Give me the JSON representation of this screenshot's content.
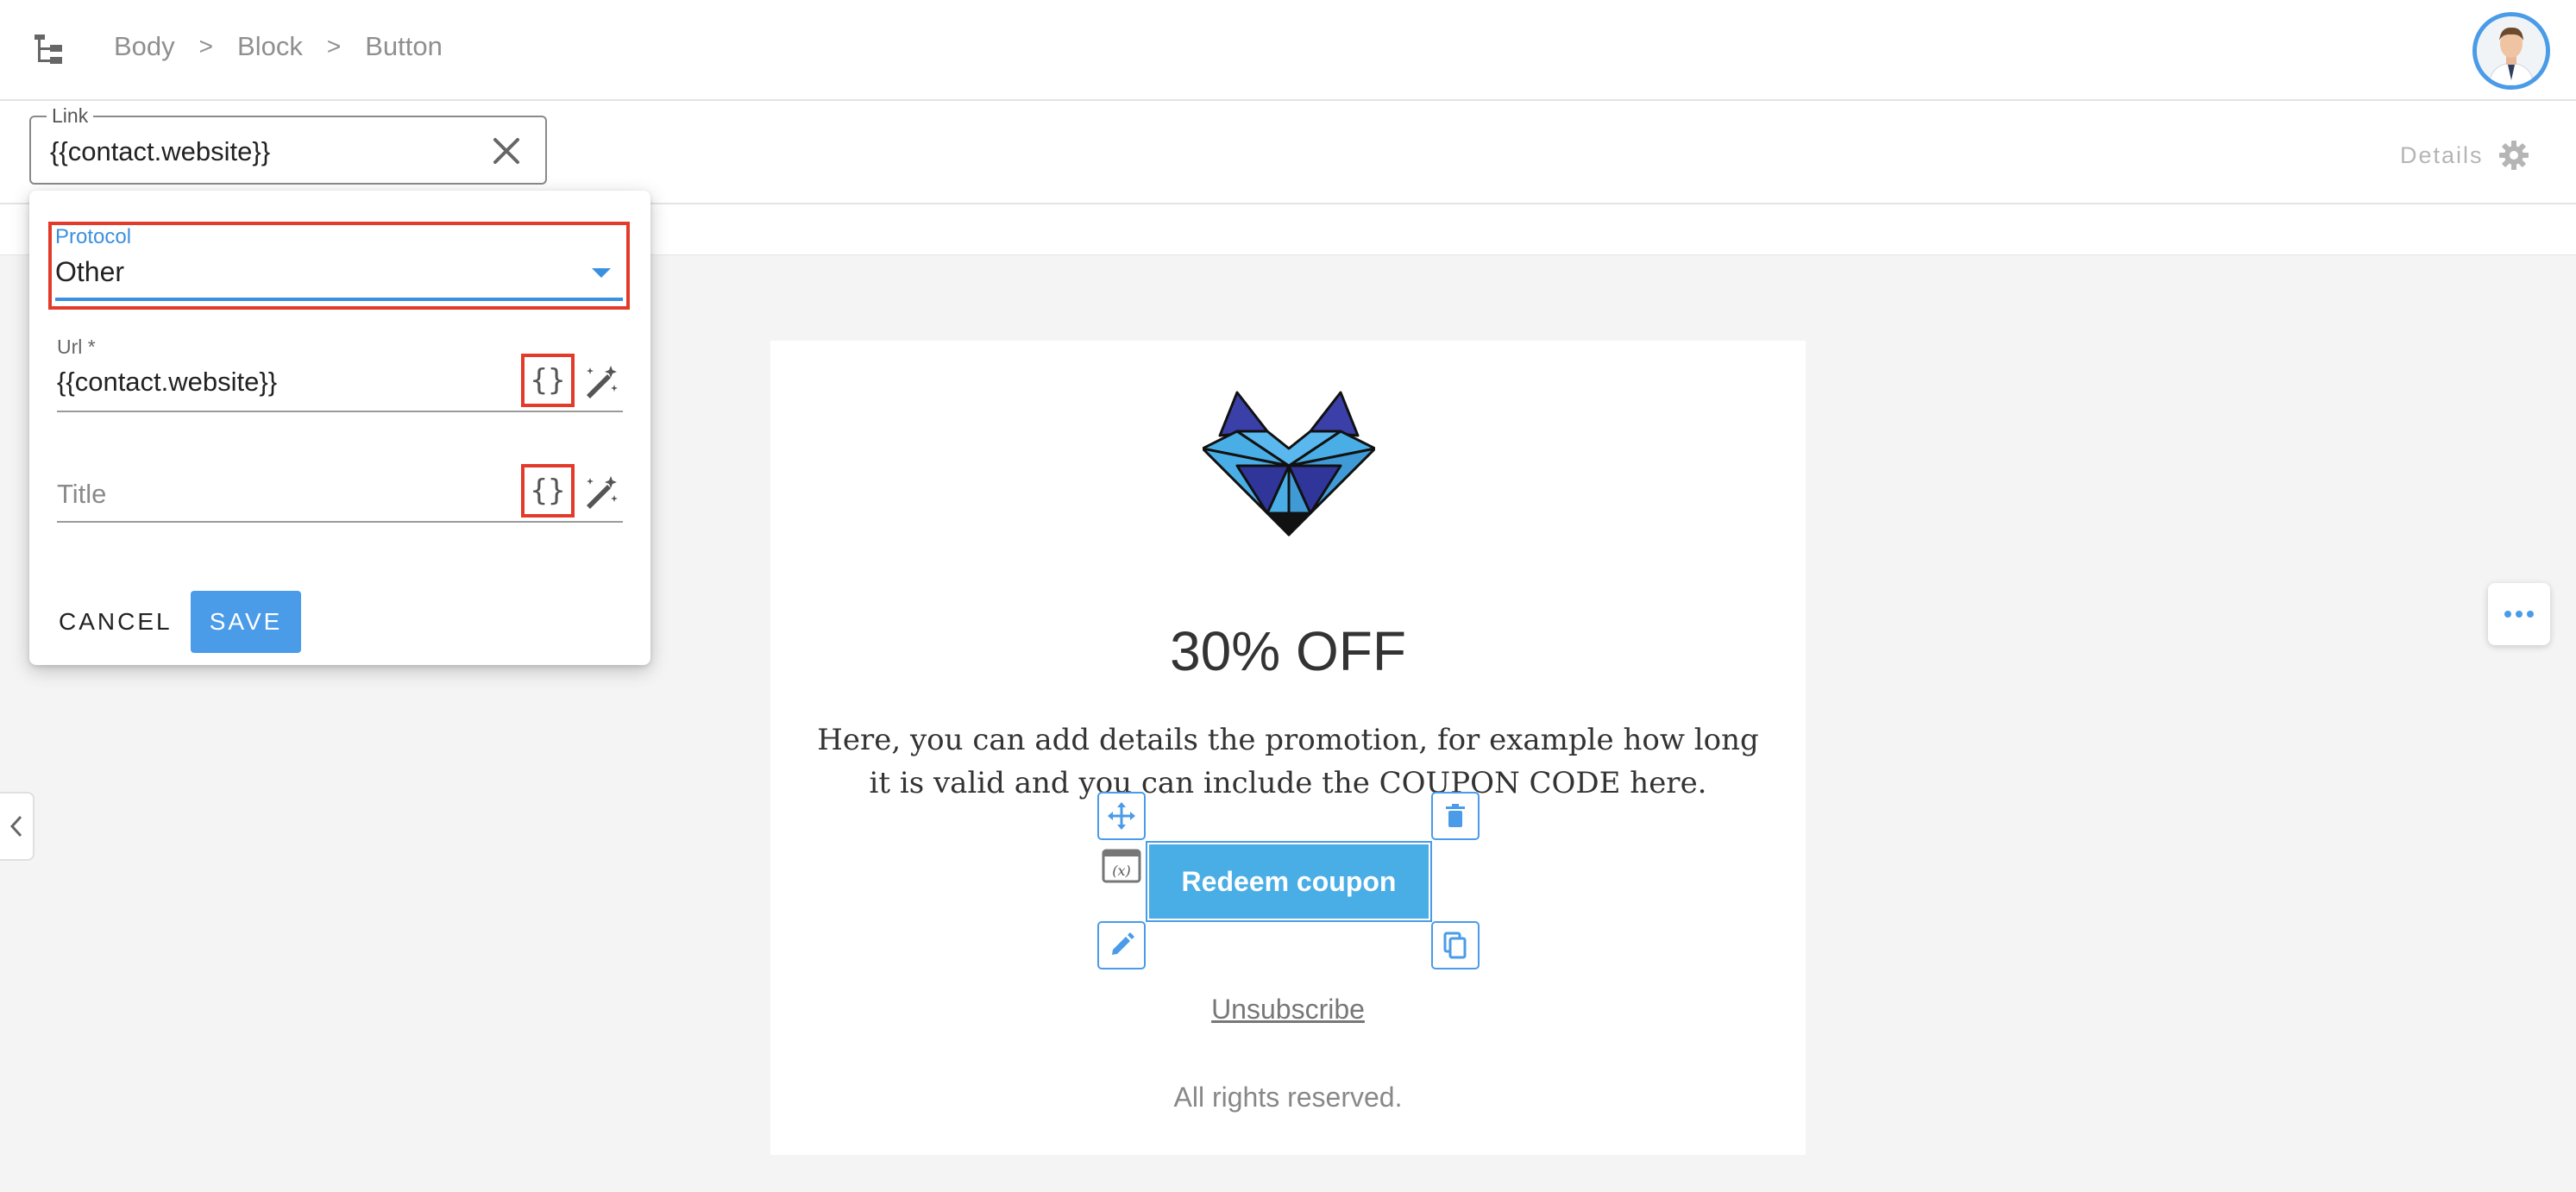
{
  "breadcrumb": {
    "items": [
      "Body",
      "Block",
      "Button"
    ],
    "separator": ">"
  },
  "link_bar": {
    "legend": "Link",
    "value": "{{contact.website}}",
    "details_label": "Details"
  },
  "popup": {
    "protocol_label": "Protocol",
    "protocol_value": "Other",
    "url_label": "Url *",
    "url_value": "{{contact.website}}",
    "title_placeholder": "Title",
    "brace_glyph": "{}",
    "cancel_label": "CANCEL",
    "save_label": "SAVE"
  },
  "email": {
    "headline": "30% OFF",
    "promo_text": "Here, you can add details  the promotion, for example how long it is valid and you can include the COUPON CODE here.",
    "button_label": "Redeem coupon",
    "unsubscribe": "Unsubscribe",
    "rights": "All rights reserved."
  },
  "colors": {
    "accent": "#4a9be8",
    "highlight": "#e23b2b",
    "button": "#4aaee6"
  },
  "icons": [
    "tree-structure-icon",
    "close-icon",
    "gear-icon",
    "chevron-down-icon",
    "magic-wand-icon",
    "move-icon",
    "trash-icon",
    "edit-icon",
    "copy-icon",
    "variable-icon",
    "more-icon",
    "chevron-left-icon"
  ]
}
